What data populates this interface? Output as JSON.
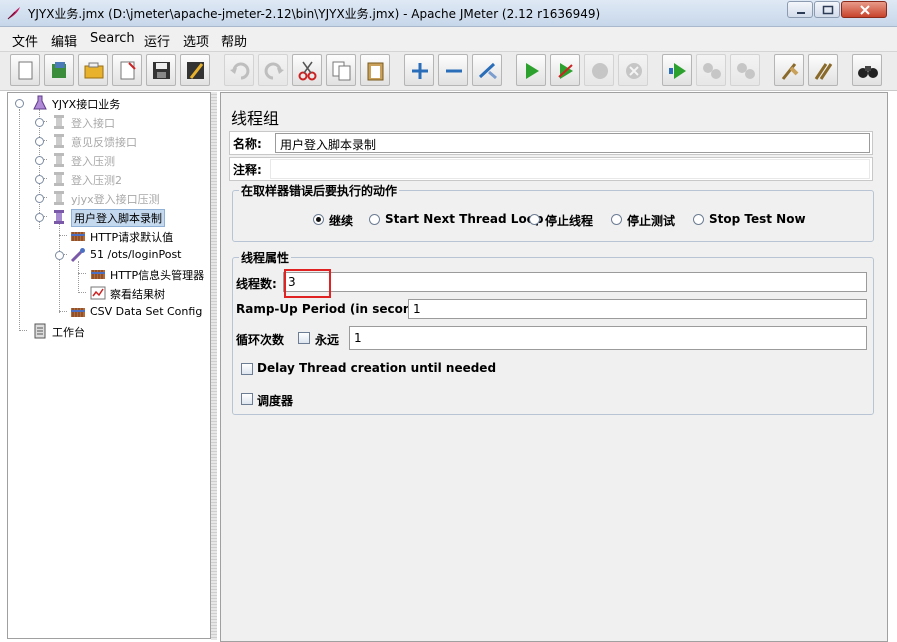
{
  "window": {
    "title": "YJYX业务.jmx (D:\\jmeter\\apache-jmeter-2.12\\bin\\YJYX业务.jmx) - Apache JMeter (2.12 r1636949)"
  },
  "menu": [
    "文件",
    "编辑",
    "Search",
    "运行",
    "选项",
    "帮助"
  ],
  "toolbar": {
    "buttons": [
      {
        "name": "new-icon",
        "enabled": true
      },
      {
        "name": "templates-icon",
        "enabled": true
      },
      {
        "name": "open-icon",
        "enabled": true
      },
      {
        "name": "close-file-icon",
        "enabled": true
      },
      {
        "name": "save-icon",
        "enabled": true
      },
      {
        "name": "save-as-icon",
        "enabled": true
      },
      {
        "name": "undo-icon",
        "enabled": false
      },
      {
        "name": "redo-icon",
        "enabled": false
      },
      {
        "name": "cut-icon",
        "enabled": true
      },
      {
        "name": "copy-icon",
        "enabled": true
      },
      {
        "name": "paste-icon",
        "enabled": true
      },
      {
        "name": "expand-icon",
        "enabled": true
      },
      {
        "name": "collapse-icon",
        "enabled": true
      },
      {
        "name": "toggle-icon",
        "enabled": true
      },
      {
        "name": "start-icon",
        "enabled": true
      },
      {
        "name": "start-no-pause-icon",
        "enabled": true
      },
      {
        "name": "stop-icon",
        "enabled": false
      },
      {
        "name": "shutdown-icon",
        "enabled": false
      },
      {
        "name": "remote-start-icon",
        "enabled": true
      },
      {
        "name": "remote-stop-icon",
        "enabled": false
      },
      {
        "name": "remote-shutdown-icon",
        "enabled": false
      },
      {
        "name": "clear-icon",
        "enabled": true
      },
      {
        "name": "clear-all-icon",
        "enabled": true
      },
      {
        "name": "search-icon",
        "enabled": true
      }
    ]
  },
  "tree": {
    "root": "YJYX接口业务",
    "items": [
      {
        "label": "登入接口",
        "disabled": true
      },
      {
        "label": "意见反馈接口",
        "disabled": true
      },
      {
        "label": "登入压测",
        "disabled": true
      },
      {
        "label": "登入压测2",
        "disabled": true
      },
      {
        "label": "yjyx登入接口压测",
        "disabled": true
      },
      {
        "label": "用户登入脚本录制",
        "disabled": false,
        "selected": true
      }
    ],
    "children": [
      {
        "label": "HTTP请求默认值"
      },
      {
        "label": "51 /ots/loginPost"
      },
      {
        "label": "HTTP信息头管理器"
      },
      {
        "label": "察看结果树"
      },
      {
        "label": "CSV Data Set Config"
      }
    ],
    "workbench": "工作台"
  },
  "panel": {
    "title": "线程组",
    "name_label": "名称:",
    "name_value": "用户登入脚本录制",
    "comment_label": "注释:",
    "comment_value": "",
    "error_group_title": "在取样器错误后要执行的动作",
    "error_options": [
      {
        "label": "继续",
        "selected": true
      },
      {
        "label": "Start Next Thread Loop",
        "selected": false
      },
      {
        "label": "停止线程",
        "selected": false
      },
      {
        "label": "停止测试",
        "selected": false
      },
      {
        "label": "Stop Test Now",
        "selected": false
      }
    ],
    "thread_group_title": "线程属性",
    "threads_label": "线程数:",
    "threads_value": "3",
    "rampup_label": "Ramp-Up Period (in seconds):",
    "rampup_value": "1",
    "loop_label": "循环次数",
    "forever_label": "永远",
    "forever_checked": false,
    "loop_value": "1",
    "delay_label": "Delay Thread creation until needed",
    "delay_checked": false,
    "scheduler_label": "调度器",
    "scheduler_checked": false
  },
  "colors": {
    "highlight": "#e02222",
    "selection": "#c4d8ee"
  }
}
